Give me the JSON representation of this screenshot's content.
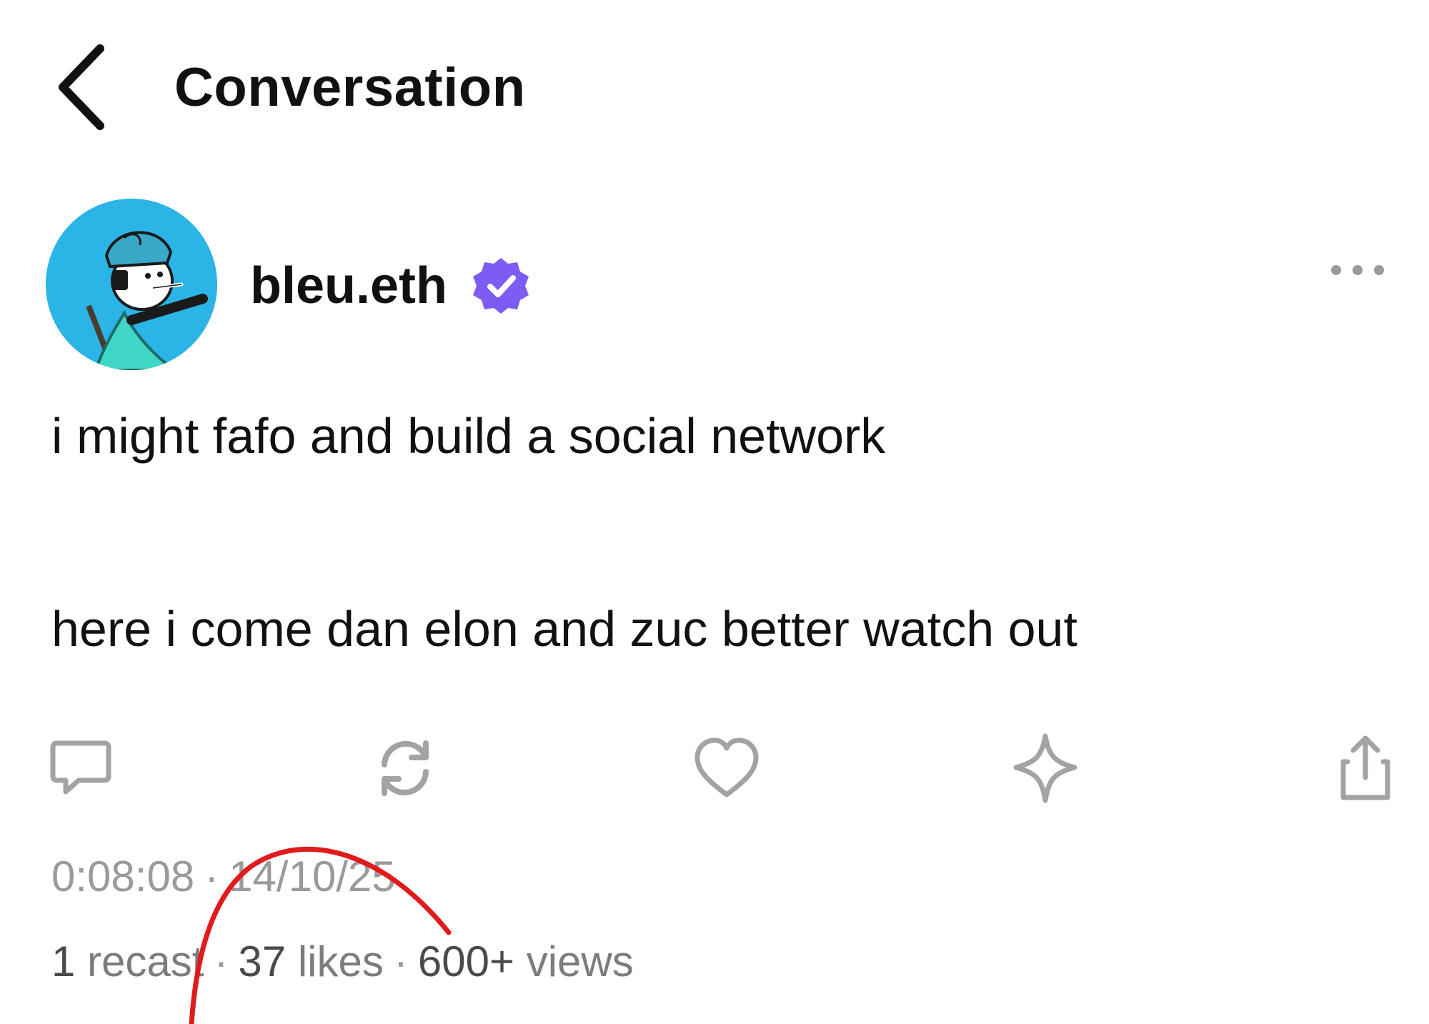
{
  "header": {
    "back_icon": "chevron-left-icon",
    "title": "Conversation"
  },
  "post": {
    "author": {
      "name": "bleu.eth",
      "verified": true,
      "avatar_bg": "#2bb4e6",
      "badge_color": "#7c5cf2"
    },
    "more_icon": "more-horizontal-icon",
    "body_lines": [
      "i might fafo and build a social network",
      "here i come dan elon and zuc better watch out"
    ],
    "actions": [
      {
        "icon": "reply-icon"
      },
      {
        "icon": "recast-icon"
      },
      {
        "icon": "heart-icon"
      },
      {
        "icon": "sparkle-icon"
      },
      {
        "icon": "share-icon"
      }
    ],
    "time": "0:08:08",
    "date": "14/10/25",
    "stats": {
      "recasts_count": "1",
      "recasts_label": "recast",
      "likes_count": "37",
      "likes_label": "likes",
      "views_count": "600+",
      "views_label": "views"
    }
  },
  "colors": {
    "text_primary": "#111111",
    "text_muted": "#9a9a9a",
    "icon_gray": "#a3a3a3",
    "annotation_red": "#e01b1b"
  }
}
